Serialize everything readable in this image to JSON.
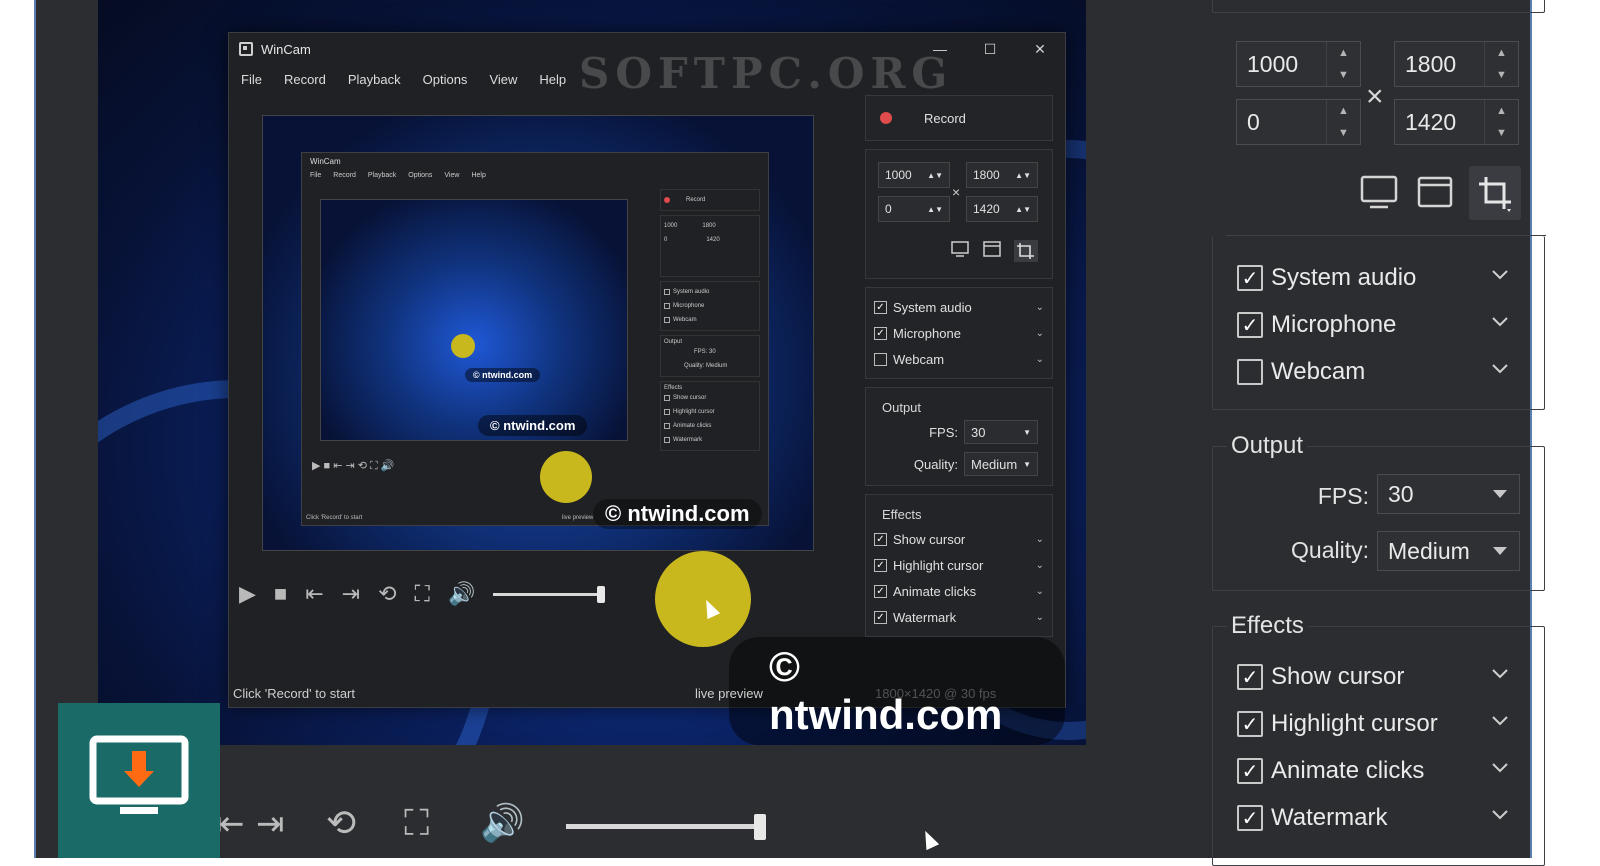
{
  "app": {
    "title": "WinCam",
    "window_controls": [
      "—",
      "☐",
      "✕"
    ],
    "menu": [
      "File",
      "Record",
      "Playback",
      "Options",
      "View",
      "Help"
    ],
    "watermark_top": "SOFTPC.ORG",
    "ntwind_mark": "© ntwind.com"
  },
  "inner": {
    "record_label": "Record",
    "region": {
      "x": "1000",
      "w": "1800",
      "y": "0",
      "h": "1420"
    },
    "audio": [
      {
        "label": "System audio",
        "checked": true
      },
      {
        "label": "Microphone",
        "checked": true
      },
      {
        "label": "Webcam",
        "checked": false
      }
    ],
    "output_legend": "Output",
    "fps_label": "FPS:",
    "fps_value": "30",
    "quality_label": "Quality:",
    "quality_value": "Medium",
    "effects_legend": "Effects",
    "effects": [
      {
        "label": "Show cursor",
        "checked": true
      },
      {
        "label": "Highlight cursor",
        "checked": true
      },
      {
        "label": "Animate clicks",
        "checked": true
      },
      {
        "label": "Watermark",
        "checked": true
      }
    ],
    "status_left": "Click 'Record' to start",
    "status_right": "live preview",
    "status_faint": "1800×1420 @ 30 fps"
  },
  "nested": {
    "title": "WinCam",
    "menu": [
      "File",
      "Record",
      "Playback",
      "Options",
      "View",
      "Help"
    ],
    "record_label": "Record",
    "region": {
      "x": "1000",
      "w": "1800",
      "y": "0",
      "h": "1420"
    },
    "audio": [
      "System audio",
      "Microphone",
      "Webcam"
    ],
    "output_legend": "Output",
    "fps": "FPS:  30",
    "quality": "Quality:  Medium",
    "effects_legend": "Effects",
    "effects": [
      "Show cursor",
      "Highlight cursor",
      "Animate clicks",
      "Watermark"
    ],
    "status_left": "Click 'Record' to start",
    "status_right": "live preview",
    "mark_small": "© ntwind.com",
    "mark_mid": "© ntwind.com"
  },
  "right": {
    "region": {
      "x": "1000",
      "w": "1800",
      "y": "0",
      "h": "1420"
    },
    "times": "×",
    "audio": [
      {
        "label": "System audio",
        "checked": true
      },
      {
        "label": "Microphone",
        "checked": true
      },
      {
        "label": "Webcam",
        "checked": false
      }
    ],
    "output_legend": "Output",
    "fps_label": "FPS:",
    "fps_value": "30",
    "quality_label": "Quality:",
    "quality_value": "Medium",
    "effects_legend": "Effects",
    "effects": [
      {
        "label": "Show cursor",
        "checked": true
      },
      {
        "label": "Highlight cursor",
        "checked": true
      },
      {
        "label": "Animate clicks",
        "checked": true
      },
      {
        "label": "Watermark",
        "checked": true
      }
    ]
  },
  "colors": {
    "frame_bg": "#2b2d30",
    "accent_record": "#e04b4b",
    "click_highlight": "#c8b81e",
    "download_badge": "#1a6b68",
    "download_arrow": "#ff6a13"
  },
  "icons": [
    "monitor-icon",
    "window-icon",
    "crop-icon",
    "play-icon",
    "stop-icon",
    "skip-start-icon",
    "skip-end-icon",
    "loop-icon",
    "fullscreen-icon",
    "volume-icon",
    "chevron-down-icon",
    "download-icon"
  ]
}
